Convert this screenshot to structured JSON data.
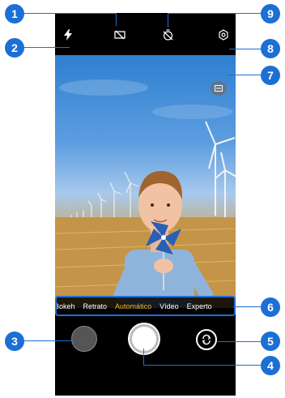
{
  "modes": [
    "Bokeh",
    "Retrato",
    "Automático",
    "Vídeo",
    "Experto"
  ],
  "active_mode": "Automático",
  "callouts": [
    "1",
    "2",
    "3",
    "4",
    "5",
    "6",
    "7",
    "8",
    "9"
  ],
  "colors": {
    "callout": "#1b6fd5",
    "active_mode": "#f0b91f",
    "strip_border": "#1f6fd6"
  },
  "icons": {
    "top_left": "flash-icon",
    "top_center": "hdr-off-icon",
    "top_right_center": "timer-off-icon",
    "top_right": "settings-icon",
    "viewfinder": "scene-mode-icon",
    "bottom_left": "gallery-thumbnail",
    "bottom_center": "shutter-button",
    "bottom_right": "switch-camera-icon"
  }
}
